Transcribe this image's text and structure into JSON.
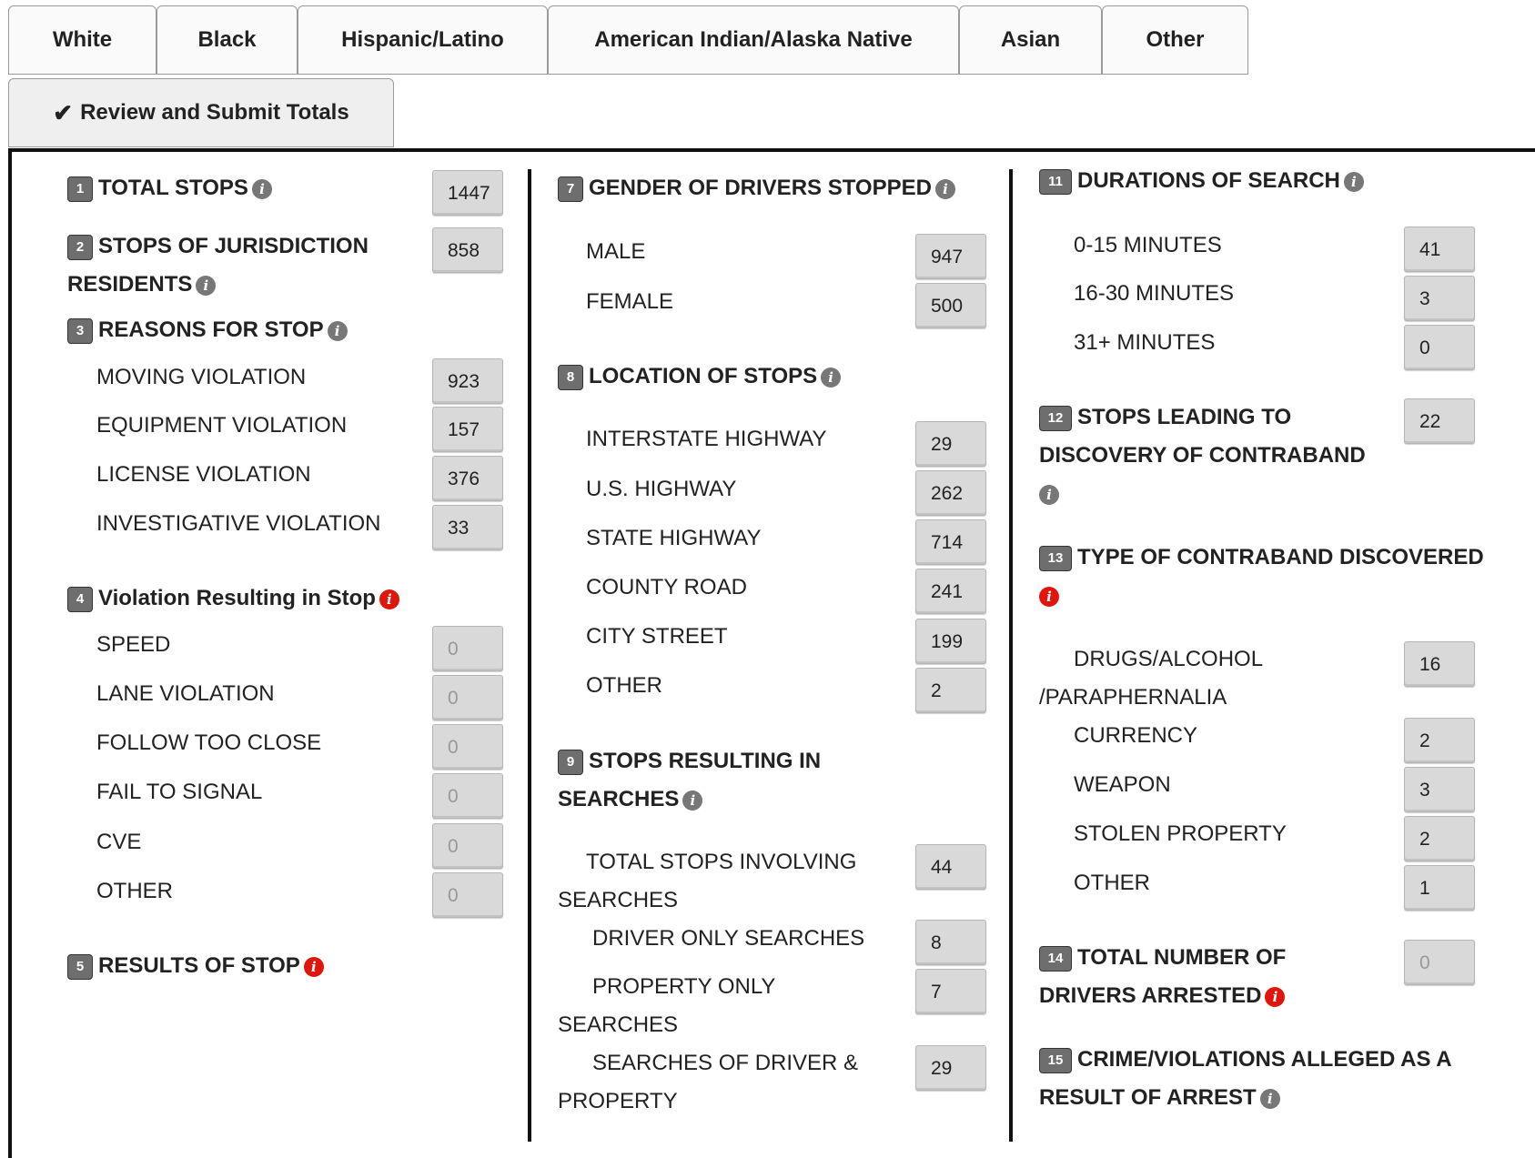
{
  "tabs": [
    "White",
    "Black",
    "Hispanic/Latino",
    "American Indian/Alaska Native",
    "Asian",
    "Other"
  ],
  "review_tab": {
    "label": "Review and Submit Totals"
  },
  "s1": {
    "num": "1",
    "title": "TOTAL STOPS",
    "value": "1447"
  },
  "s2": {
    "num": "2",
    "title": "STOPS OF JURISDICTION",
    "title2": "RESIDENTS",
    "value": "858"
  },
  "s3": {
    "num": "3",
    "title": "REASONS FOR STOP",
    "items": [
      {
        "label": "MOVING VIOLATION",
        "value": "923"
      },
      {
        "label": "EQUIPMENT VIOLATION",
        "value": "157"
      },
      {
        "label": "LICENSE VIOLATION",
        "value": "376"
      },
      {
        "label": "INVESTIGATIVE VIOLATION",
        "value": "33"
      }
    ]
  },
  "s4": {
    "num": "4",
    "title": "Violation Resulting in Stop",
    "items": [
      {
        "label": "SPEED",
        "value": "0"
      },
      {
        "label": "LANE VIOLATION",
        "value": "0"
      },
      {
        "label": "FOLLOW TOO CLOSE",
        "value": "0"
      },
      {
        "label": "FAIL TO SIGNAL",
        "value": "0"
      },
      {
        "label": "CVE",
        "value": "0"
      },
      {
        "label": "OTHER",
        "value": "0"
      }
    ]
  },
  "s5": {
    "num": "5",
    "title": "RESULTS OF STOP"
  },
  "s7": {
    "num": "7",
    "title": "GENDER OF DRIVERS STOPPED",
    "items": [
      {
        "label": "MALE",
        "value": "947"
      },
      {
        "label": "FEMALE",
        "value": "500"
      }
    ]
  },
  "s8": {
    "num": "8",
    "title": "LOCATION OF STOPS",
    "items": [
      {
        "label": "INTERSTATE HIGHWAY",
        "value": "29"
      },
      {
        "label": "U.S. HIGHWAY",
        "value": "262"
      },
      {
        "label": "STATE HIGHWAY",
        "value": "714"
      },
      {
        "label": "COUNTY ROAD",
        "value": "241"
      },
      {
        "label": "CITY STREET",
        "value": "199"
      },
      {
        "label": "OTHER",
        "value": "2"
      }
    ]
  },
  "s9": {
    "num": "9",
    "title": "STOPS RESULTING IN",
    "title2": "SEARCHES",
    "items": [
      {
        "label": "TOTAL STOPS INVOLVING",
        "label2": "SEARCHES",
        "value": "44"
      },
      {
        "label": "DRIVER ONLY SEARCHES",
        "value": "8"
      },
      {
        "label": "PROPERTY ONLY",
        "label2": "SEARCHES",
        "value": "7"
      },
      {
        "label": "SEARCHES OF DRIVER &",
        "label2": "PROPERTY",
        "value": "29"
      }
    ]
  },
  "s11": {
    "num": "11",
    "title": "DURATIONS OF SEARCH",
    "items": [
      {
        "label": "0-15 MINUTES",
        "value": "41"
      },
      {
        "label": "16-30 MINUTES",
        "value": "3"
      },
      {
        "label": "31+ MINUTES",
        "value": "0"
      }
    ]
  },
  "s12": {
    "num": "12",
    "title": "STOPS LEADING TO",
    "title2": "DISCOVERY OF CONTRABAND",
    "value": "22"
  },
  "s13": {
    "num": "13",
    "title": "TYPE OF CONTRABAND DISCOVERED",
    "items": [
      {
        "label": "DRUGS/ALCOHOL",
        "label2": "/PARAPHERNALIA",
        "value": "16"
      },
      {
        "label": "CURRENCY",
        "value": "2"
      },
      {
        "label": "WEAPON",
        "value": "3"
      },
      {
        "label": "STOLEN PROPERTY",
        "value": "2"
      },
      {
        "label": "OTHER",
        "value": "1"
      }
    ]
  },
  "s14": {
    "num": "14",
    "title": "TOTAL NUMBER OF",
    "title2": "DRIVERS ARRESTED",
    "placeholder": "0"
  },
  "s15": {
    "num": "15",
    "title": "CRIME/VIOLATIONS ALLEGED AS A",
    "title2": "RESULT OF ARREST"
  },
  "colors": {
    "info_gray": "#777777",
    "info_red": "#e0150b",
    "input_bg": "#d9d9d9"
  },
  "icons": {
    "check": "check-icon",
    "info": "info-icon"
  }
}
